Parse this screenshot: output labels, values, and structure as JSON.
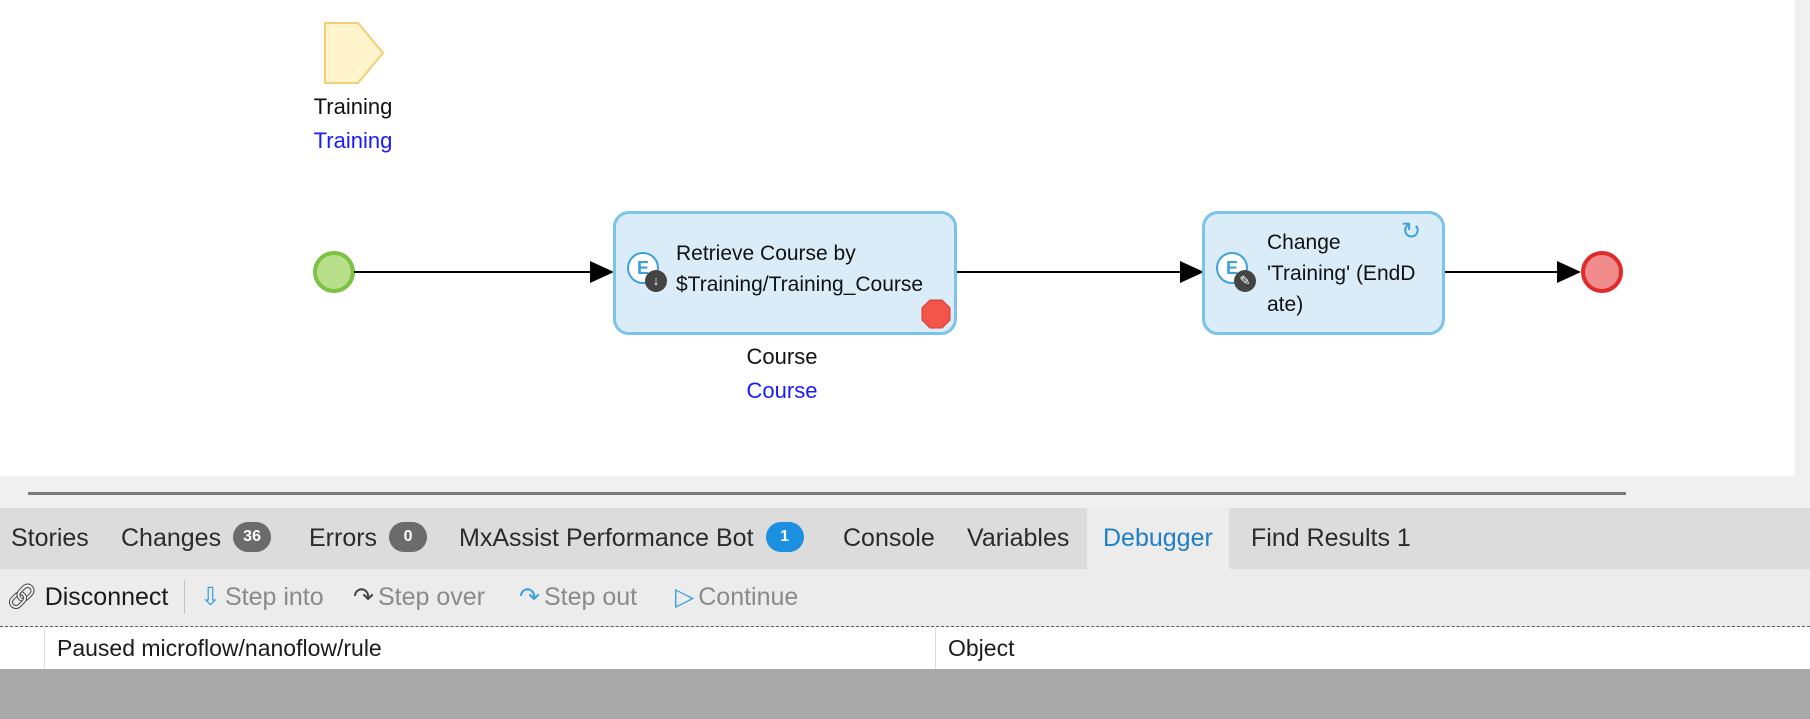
{
  "parameter": {
    "name": "Training",
    "type": "Training"
  },
  "activities": [
    {
      "text": "Retrieve Course by\n$Training/Training_Course",
      "output_name": "Course",
      "output_type": "Course",
      "icon": "entity-retrieve-icon",
      "breakpoint": true
    },
    {
      "text": "Change\n'Training' (EndD\nate)",
      "icon": "entity-change-icon",
      "refresh": true
    }
  ],
  "tabs": [
    {
      "label": "Stories"
    },
    {
      "label": "Changes",
      "badge": "36"
    },
    {
      "label": "Errors",
      "badge": "0"
    },
    {
      "label": "MxAssist Performance Bot",
      "badge": "1"
    },
    {
      "label": "Console"
    },
    {
      "label": "Variables"
    },
    {
      "label": "Debugger",
      "active": true
    },
    {
      "label": "Find Results 1"
    }
  ],
  "toolbar": {
    "disconnect": "Disconnect",
    "step_into": "Step into",
    "step_over": "Step over",
    "step_out": "Step out",
    "continue": "Continue"
  },
  "grid": {
    "columns": [
      "Paused microflow/nanoflow/rule",
      "Object"
    ]
  },
  "colors": {
    "start_event": "#b8e08a",
    "end_event": "#f28b8b",
    "activity_fill": "#d9ecf8",
    "activity_border": "#7cc3ea",
    "active_tab_text": "#1e7ec8",
    "badge_blue": "#1b8fe0"
  }
}
